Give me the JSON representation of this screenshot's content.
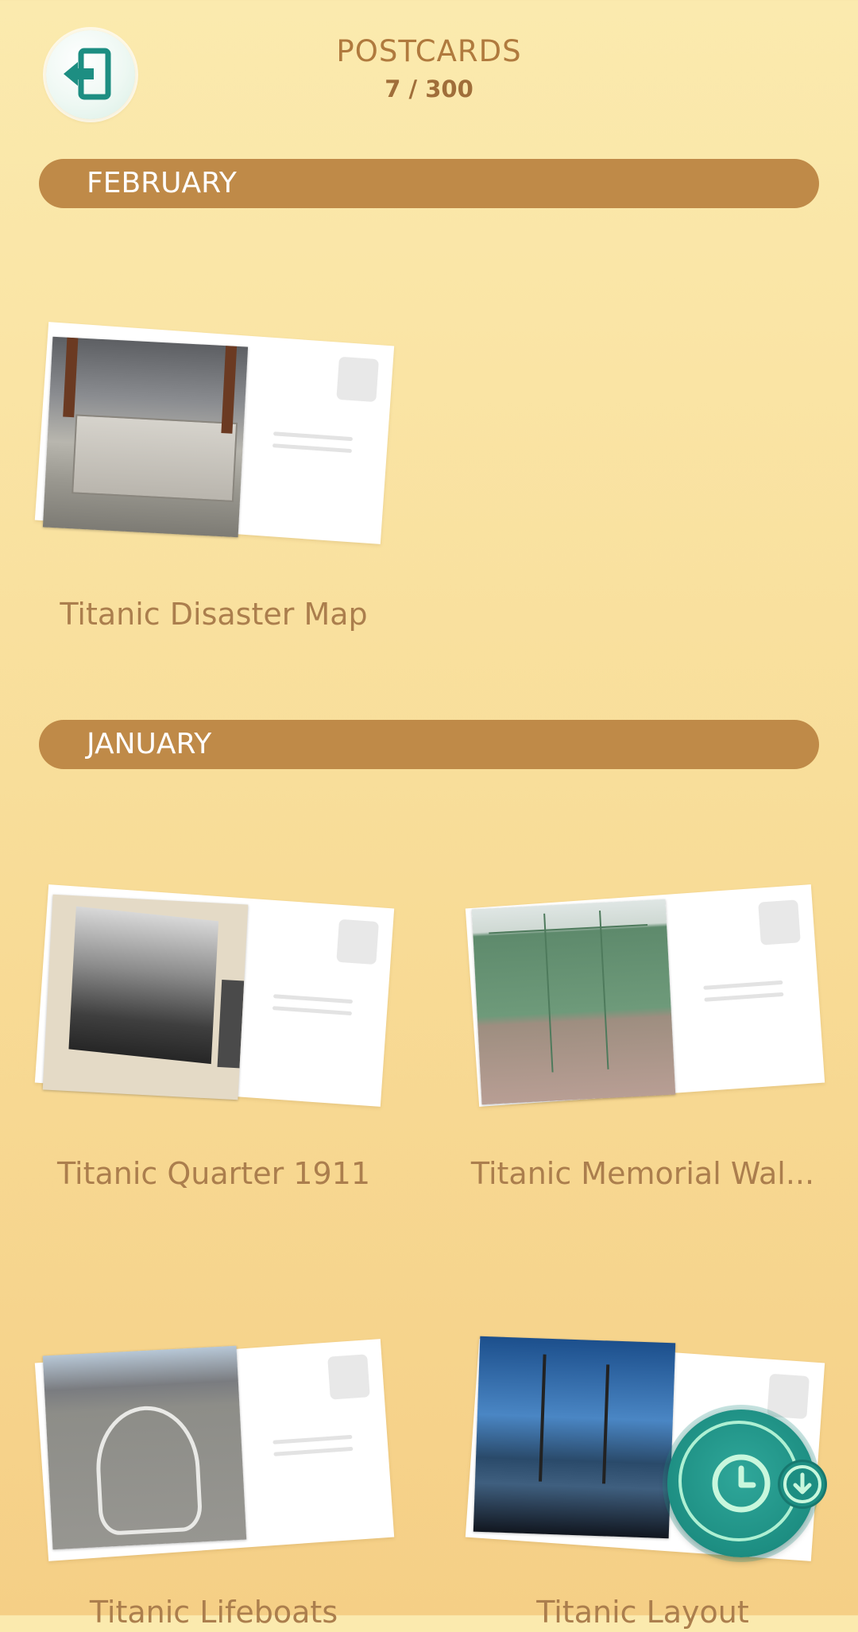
{
  "header": {
    "title": "POSTCARDS",
    "count": "7 / 300"
  },
  "exit_button": {
    "icon": "exit-door-arrow-icon"
  },
  "sections": [
    {
      "label": "FEBRUARY",
      "postcards": [
        {
          "caption": "Titanic Disaster Map"
        }
      ]
    },
    {
      "label": "JANUARY",
      "postcards": [
        {
          "caption": "Titanic Quarter 1911"
        },
        {
          "caption": "Titanic Memorial Wal..."
        },
        {
          "caption": "Titanic Lifeboats"
        },
        {
          "caption": "Titanic Layout"
        }
      ]
    }
  ],
  "fab": {
    "icon": "clock-icon",
    "badge_icon": "download-arrow-icon"
  },
  "colors": {
    "background": "#f8dc97",
    "section_bar": "#bf8a48",
    "title_text": "#b07a3e",
    "caption_text": "#ab7e4d",
    "fab_teal": "#1d8e82"
  }
}
